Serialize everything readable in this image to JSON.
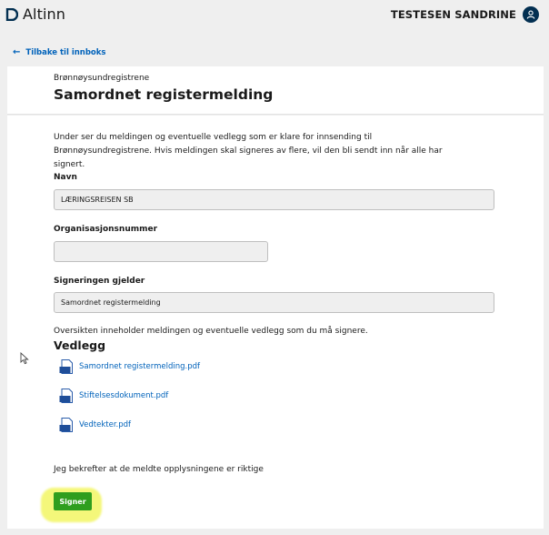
{
  "header": {
    "logo_text": "Altinn",
    "user_name": "TESTESEN SANDRINE"
  },
  "nav": {
    "back_label": "Tilbake til innboks"
  },
  "form": {
    "org_name": "Brønnøysundregistrene",
    "title": "Samordnet registermelding",
    "intro": "Under ser du meldingen og eventuelle vedlegg som er klare for innsending til Brønnøysundregistrene. Hvis meldingen skal signeres av flere, vil den bli sendt inn når alle har signert.",
    "fields": [
      {
        "label": "Navn",
        "value": "LÆRINGSREISEN SB"
      },
      {
        "label": "Organisasjonsnummer",
        "value": ""
      },
      {
        "label": "Signeringen gjelder",
        "value": "Samordnet registermelding"
      }
    ],
    "overview_text": "Oversikten inneholder meldingen og eventuelle vedlegg som du må signere.",
    "attachments_title": "Vedlegg",
    "attachments": [
      {
        "name": "Samordnet registermelding.pdf",
        "badge": "PDF"
      },
      {
        "name": "Stiftelsesdokument.pdf",
        "badge": "PDF"
      },
      {
        "name": "Vedtekter.pdf",
        "badge": "PDF"
      }
    ],
    "confirm_text": "Jeg bekrefter at de meldte opplysningene er riktige",
    "sign_button": "Signer"
  },
  "colors": {
    "brand": "#022f51",
    "link": "#0062ba",
    "button": "#2f9e1e",
    "highlight": "#f4f77a"
  }
}
